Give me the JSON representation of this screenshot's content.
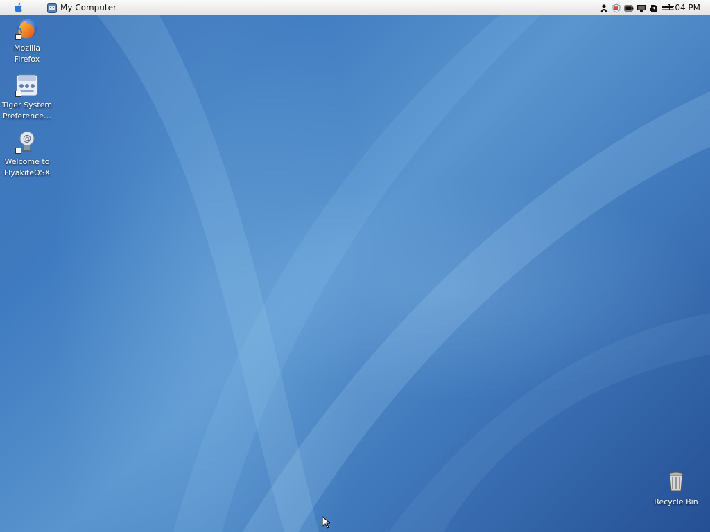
{
  "menubar": {
    "active_app": "My Computer",
    "clock": "1:04 PM"
  },
  "icons": {
    "apple": "apple-menu-icon",
    "finder": "finder-icon",
    "tray": [
      "user-icon",
      "shield-icon",
      "battery-icon",
      "monitor-icon",
      "network-icon",
      "volume-icon"
    ]
  },
  "desktop": {
    "firefox": "Mozilla\nFirefox",
    "tiger": "Tiger System\nPreference…",
    "welcome": "Welcome to\nFlyakiteOSX",
    "recycle": "Recycle Bin"
  },
  "colors": {
    "menubar_top": "#fbfbfb",
    "menubar_bottom": "#e4e4e4",
    "wallpaper_light": "#5a95cf",
    "wallpaper_dark": "#254f94",
    "icon_label": "#ffffff"
  }
}
